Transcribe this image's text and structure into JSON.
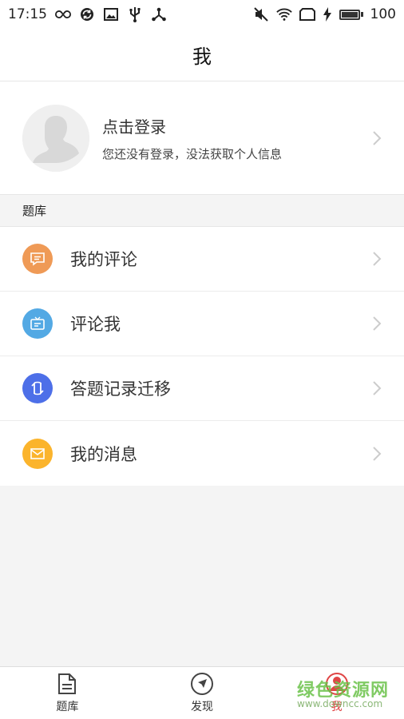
{
  "status_bar": {
    "time": "17:15",
    "battery_level": 100,
    "battery_text": "100",
    "left_icons": [
      "infinity-icon",
      "sync-icon",
      "image-icon",
      "usb-icon",
      "share-nodes-icon"
    ],
    "right_icons": [
      "mute-icon",
      "wifi-icon",
      "screen-rotate-icon",
      "charging-icon",
      "battery-icon"
    ]
  },
  "header": {
    "title": "我"
  },
  "profile": {
    "title": "点击登录",
    "subtitle": "您还没有登录，没法获取个人信息"
  },
  "section": {
    "label": "题库"
  },
  "menu": {
    "items": [
      {
        "label": "我的评论",
        "icon": "comment-icon",
        "color": "#ef9a56"
      },
      {
        "label": "评论我",
        "icon": "tv-icon",
        "color": "#53a9e4"
      },
      {
        "label": "答题记录迁移",
        "icon": "transfer-icon",
        "color": "#4d6fe8"
      },
      {
        "label": "我的消息",
        "icon": "mail-icon",
        "color": "#fbb42c"
      }
    ]
  },
  "bottom_nav": {
    "items": [
      {
        "label": "题库",
        "icon": "document-icon",
        "active": false
      },
      {
        "label": "发现",
        "icon": "compass-icon",
        "active": false
      },
      {
        "label": "我",
        "icon": "person-icon",
        "active": true
      }
    ],
    "active_color": "#e04545"
  },
  "watermark": {
    "text": "绿色资源网",
    "url": "www.downcc.com"
  }
}
